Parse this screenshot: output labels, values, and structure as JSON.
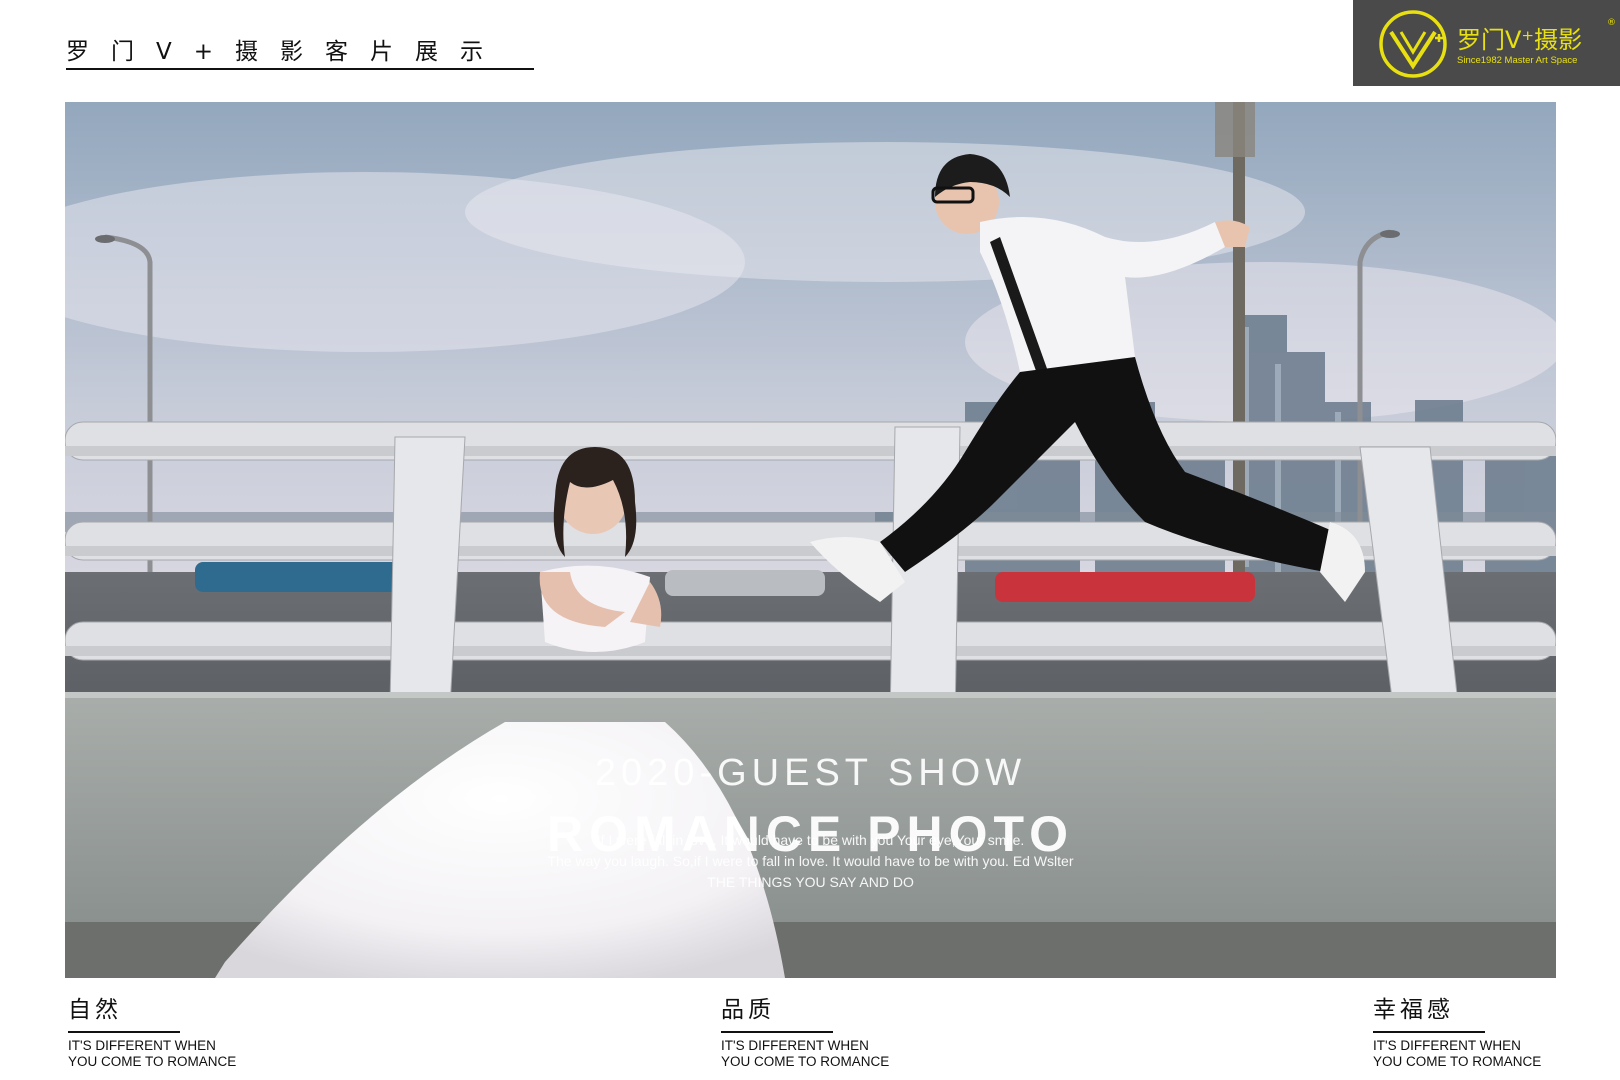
{
  "header": {
    "title": "罗门V+摄影客片展示"
  },
  "logo": {
    "brand": "罗门V⁺摄影",
    "registered": "®",
    "tagline": "Since1982 Master Art Space",
    "accent_color": "#e8e010",
    "background_color": "#4a4a4a"
  },
  "photo": {
    "subtitle": "2020-GUEST SHOW",
    "title": "ROMANCE PHOTO",
    "lines": [
      "If I were fall in love. It would have to be with you Your eye,Your smile.",
      "The way you laugh. So,if I were to fall in love. It would have to be with you. Ed Wslter",
      "THE THINGS YOU SAY AND DO"
    ]
  },
  "features": [
    {
      "title": "自然",
      "line1": "IT'S DIFFERENT WHEN",
      "line2": "YOU COME TO ROMANCE"
    },
    {
      "title": "品质",
      "line1": "IT'S DIFFERENT WHEN",
      "line2": "YOU COME TO ROMANCE"
    },
    {
      "title": "幸福感",
      "line1": "IT'S DIFFERENT WHEN",
      "line2": "YOU COME TO ROMANCE"
    }
  ]
}
